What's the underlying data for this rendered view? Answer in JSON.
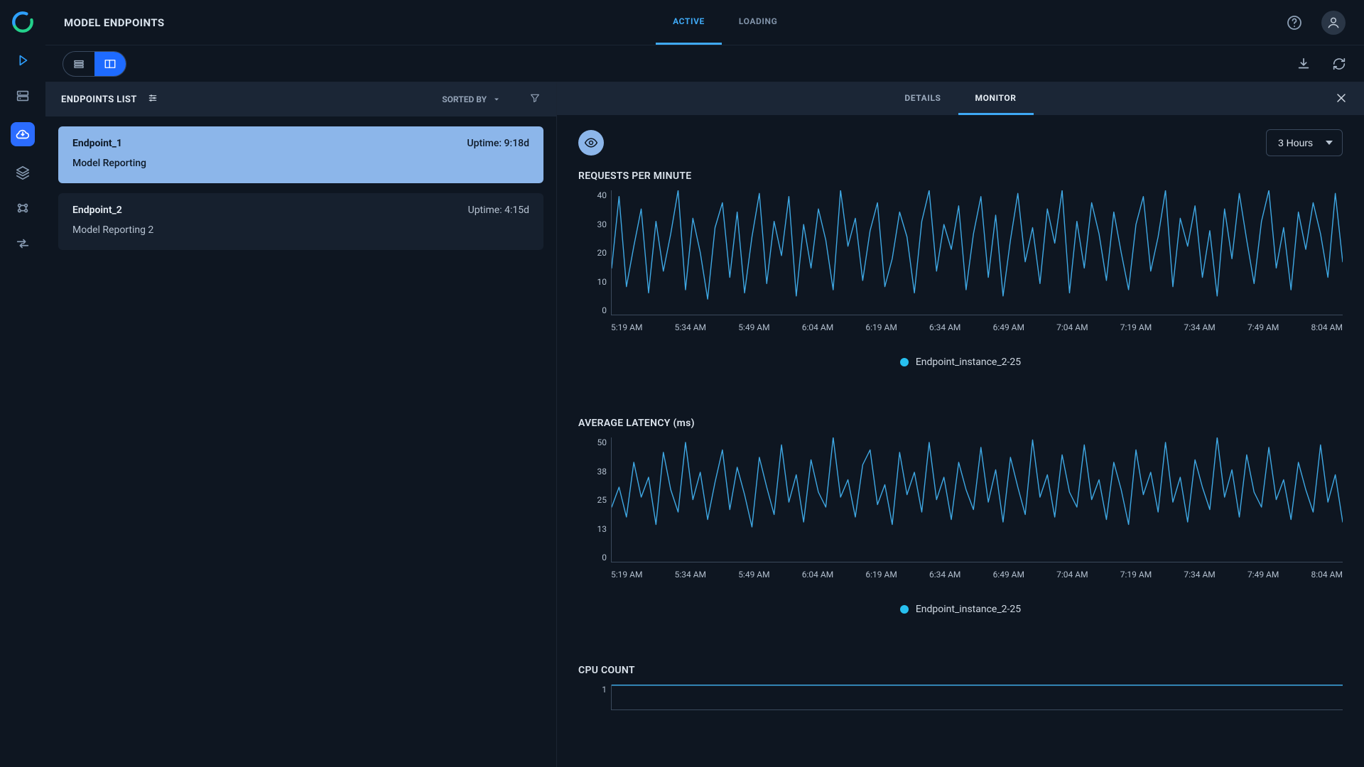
{
  "app": {
    "title": "MODEL ENDPOINTS",
    "tabs": {
      "active": "ACTIVE",
      "loading": "LOADING",
      "selected": "ACTIVE"
    }
  },
  "sidebar_icons": [
    "play",
    "server",
    "cloud",
    "layers",
    "brain",
    "swap"
  ],
  "list": {
    "header": "ENDPOINTS LIST",
    "sorted_label": "SORTED BY",
    "items": [
      {
        "name": "Endpoint_1",
        "uptime_label": "Uptime: 9:18d",
        "subtitle": "Model Reporting",
        "selected": true
      },
      {
        "name": "Endpoint_2",
        "uptime_label": "Uptime: 4:15d",
        "subtitle": "Model Reporting 2",
        "selected": false
      }
    ]
  },
  "detail_tabs": {
    "details": "DETAILS",
    "monitor": "MONITOR",
    "selected": "MONITOR"
  },
  "monitor": {
    "range_options": [
      "3 Hours"
    ],
    "range_selected": "3 Hours",
    "legend_label": "Endpoint_instance_2-25"
  },
  "x_ticks": [
    "5:19 AM",
    "5:34 AM",
    "5:49 AM",
    "6:04 AM",
    "6:19 AM",
    "6:34 AM",
    "6:49 AM",
    "7:04 AM",
    "7:19 AM",
    "7:34 AM",
    "7:49 AM",
    "8:04 AM"
  ],
  "charts": {
    "rpm": {
      "title": "REQUESTS PER MINUTE",
      "yticks": [
        "40",
        "30",
        "20",
        "10",
        "0"
      ]
    },
    "latency": {
      "title": "AVERAGE LATENCY (ms)",
      "yticks": [
        "50",
        "38",
        "25",
        "13",
        "0"
      ]
    },
    "cpu": {
      "title": "CPU COUNT",
      "yticks": [
        "1"
      ]
    }
  },
  "chart_data": [
    {
      "type": "line",
      "title": "REQUESTS PER MINUTE",
      "xlabel": "",
      "ylabel": "requests/min",
      "ylim": [
        0,
        40
      ],
      "x_categories": [
        "5:19 AM",
        "5:34 AM",
        "5:49 AM",
        "6:04 AM",
        "6:19 AM",
        "6:34 AM",
        "6:49 AM",
        "7:04 AM",
        "7:19 AM",
        "7:34 AM",
        "7:49 AM",
        "8:04 AM"
      ],
      "series": [
        {
          "name": "Endpoint_instance_2-25",
          "values": [
            15,
            38,
            9,
            22,
            34,
            7,
            30,
            14,
            26,
            40,
            8,
            31,
            20,
            5,
            28,
            36,
            12,
            33,
            7,
            25,
            39,
            10,
            30,
            19,
            38,
            6,
            29,
            15,
            34,
            24,
            8,
            40,
            22,
            31,
            11,
            27,
            36,
            9,
            18,
            33,
            25,
            7,
            30,
            40,
            14,
            29,
            21,
            35,
            8,
            26,
            38,
            12,
            32,
            6,
            24,
            39,
            17,
            28,
            10,
            34,
            23,
            40,
            7,
            30,
            15,
            36,
            26,
            11,
            33,
            20,
            8,
            29,
            38,
            14,
            25,
            40,
            9,
            31,
            22,
            35,
            12,
            27,
            6,
            34,
            18,
            39,
            24,
            10,
            30,
            40,
            15,
            28,
            8,
            33,
            21,
            36,
            26,
            12,
            39,
            17
          ]
        }
      ]
    },
    {
      "type": "line",
      "title": "AVERAGE LATENCY (ms)",
      "xlabel": "",
      "ylabel": "ms",
      "ylim": [
        0,
        50
      ],
      "x_categories": [
        "5:19 AM",
        "5:34 AM",
        "5:49 AM",
        "6:04 AM",
        "6:19 AM",
        "6:34 AM",
        "6:49 AM",
        "7:04 AM",
        "7:19 AM",
        "7:34 AM",
        "7:49 AM",
        "8:04 AM"
      ],
      "series": [
        {
          "name": "Endpoint_instance_2-25",
          "values": [
            22,
            30,
            18,
            40,
            26,
            34,
            15,
            44,
            29,
            20,
            48,
            25,
            36,
            17,
            32,
            45,
            21,
            38,
            27,
            14,
            42,
            30,
            19,
            47,
            24,
            35,
            16,
            41,
            28,
            22,
            50,
            26,
            33,
            18,
            39,
            45,
            23,
            31,
            15,
            44,
            27,
            36,
            20,
            48,
            25,
            34,
            17,
            40,
            29,
            21,
            46,
            24,
            37,
            16,
            42,
            30,
            19,
            49,
            26,
            35,
            18,
            43,
            28,
            22,
            47,
            25,
            33,
            17,
            40,
            29,
            15,
            45,
            27,
            36,
            20,
            48,
            24,
            34,
            16,
            41,
            30,
            21,
            50,
            26,
            37,
            18,
            43,
            28,
            22,
            46,
            25,
            33,
            17,
            40,
            29,
            20,
            47,
            24,
            35,
            16
          ]
        }
      ]
    },
    {
      "type": "line",
      "title": "CPU COUNT",
      "xlabel": "",
      "ylabel": "count",
      "ylim": [
        0,
        1
      ],
      "x_categories": [
        "5:19 AM",
        "5:34 AM",
        "5:49 AM",
        "6:04 AM",
        "6:19 AM",
        "6:34 AM",
        "6:49 AM",
        "7:04 AM",
        "7:19 AM",
        "7:34 AM",
        "7:49 AM",
        "8:04 AM"
      ],
      "series": [
        {
          "name": "Endpoint_instance_2-25",
          "values": [
            1,
            1,
            1,
            1,
            1,
            1,
            1,
            1,
            1,
            1,
            1,
            1
          ]
        }
      ]
    }
  ]
}
